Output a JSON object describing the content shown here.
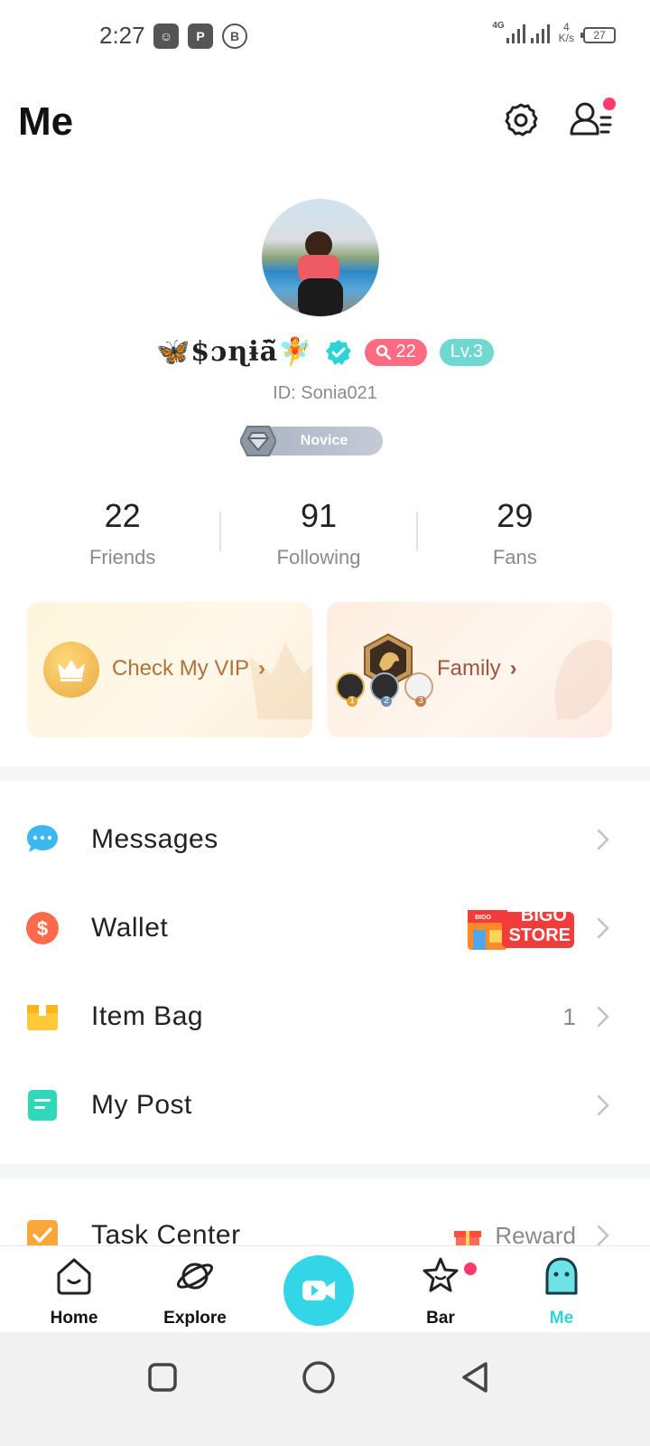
{
  "status_bar": {
    "time": "2:27",
    "network": "4G",
    "speed_value": "4",
    "speed_unit": "K/s",
    "battery": "27"
  },
  "header": {
    "title": "Me"
  },
  "profile": {
    "username": "🦋$ɔɳɨā̃🧚",
    "heart_count": "22",
    "level": "Lv.3",
    "user_id": "ID: Sonia021",
    "rank_badge": "Novice"
  },
  "stats": [
    {
      "value": "22",
      "label": "Friends"
    },
    {
      "value": "91",
      "label": "Following"
    },
    {
      "value": "29",
      "label": "Fans"
    }
  ],
  "cards": {
    "vip": {
      "label": "Check My VIP"
    },
    "family": {
      "label": "Family",
      "medals": [
        "1",
        "2",
        "3"
      ]
    }
  },
  "menu": {
    "messages": {
      "label": "Messages"
    },
    "wallet": {
      "label": "Wallet",
      "store_top": "BIGO",
      "store_bottom": "STORE",
      "store_tag": "BIGO"
    },
    "item_bag": {
      "label": "Item Bag",
      "count": "1"
    },
    "my_post": {
      "label": "My Post"
    },
    "task_center": {
      "label": "Task Center",
      "reward": "Reward"
    }
  },
  "bottom_nav": {
    "home": "Home",
    "explore": "Explore",
    "bar": "Bar",
    "me": "Me"
  },
  "colors": {
    "accent": "#2ed3d8",
    "notification": "#ff3b6b",
    "vip_text": "#b0723a"
  }
}
